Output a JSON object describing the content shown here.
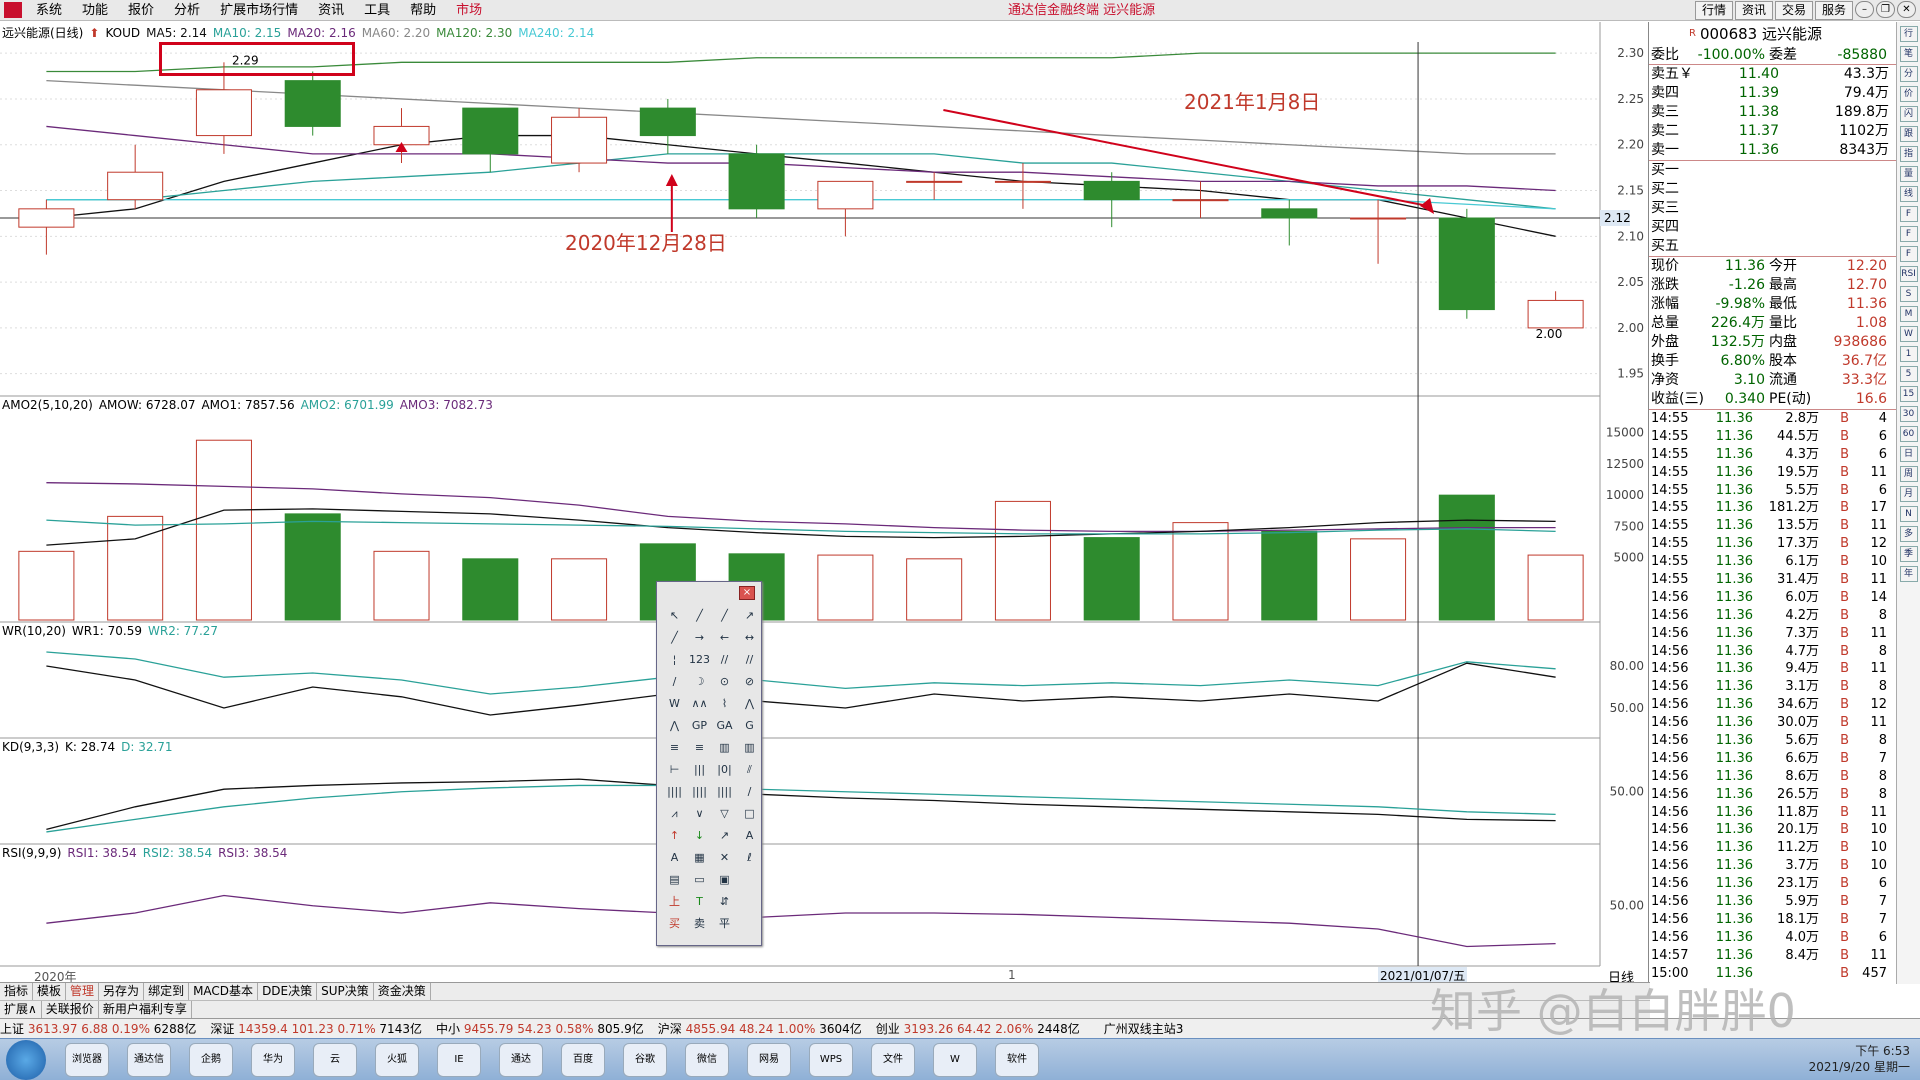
{
  "menubar": {
    "items": [
      "系统",
      "功能",
      "报价",
      "分析",
      "扩展市场行情",
      "资讯",
      "工具",
      "帮助"
    ],
    "market": "市场",
    "app_title": "通达信金融终端 远兴能源",
    "right_buttons": [
      "行情",
      "资讯",
      "交易",
      "服务"
    ]
  },
  "main_panel": {
    "title": "远兴能源(日线)",
    "indicator": "KOUD",
    "ma5": "MA5: 2.14",
    "ma10": "MA10: 2.15",
    "ma20": "MA20: 2.16",
    "ma60": "MA60: 2.20",
    "ma120": "MA120: 2.30",
    "ma240": "MA240: 2.14",
    "high_label": "2.29",
    "low_label": "2.00",
    "current_price_tag": "2.12",
    "y_ticks": [
      "2.30",
      "2.25",
      "2.20",
      "2.15",
      "2.10",
      "2.05",
      "2.00",
      "1.95"
    ]
  },
  "annotations": {
    "date1": "2021年1月8日",
    "date2": "2020年12月28日"
  },
  "amo_panel": {
    "title": "AMO2(5,10,20)",
    "amow": "AMOW: 6728.07",
    "amo1": "AMO1: 7857.56",
    "amo2": "AMO2: 6701.99",
    "amo3": "AMO3: 7082.73",
    "y_ticks": [
      "15000",
      "12500",
      "10000",
      "7500",
      "5000"
    ]
  },
  "wr_panel": {
    "title": "WR(10,20)",
    "wr1": "WR1: 70.59",
    "wr2": "WR2: 77.27",
    "y_ticks": [
      "80.00",
      "50.00"
    ]
  },
  "kd_panel": {
    "title": "KD(9,3,3)",
    "k": "K: 28.74",
    "d": "D: 32.71",
    "y_ticks": [
      "50.00"
    ]
  },
  "rsi_panel": {
    "title": "RSI(9,9,9)",
    "rsi1": "RSI1: 38.54",
    "rsi2": "RSI2: 38.54",
    "rsi3": "RSI3: 38.54",
    "y_ticks": [
      "50.00"
    ]
  },
  "x_axis": {
    "year_label": "2020年",
    "mid_label": "1",
    "date_label": "2021/01/07/五",
    "period": "日线"
  },
  "quote": {
    "code": "000683",
    "name": "远兴能源",
    "webi_label": "委比",
    "webi_value": "-100.00%",
    "weicha_label": "委差",
    "weicha_value": "-85880",
    "sells": [
      {
        "label": "卖五￥",
        "price": "11.40",
        "vol": "43.3万"
      },
      {
        "label": "卖四",
        "price": "11.39",
        "vol": "79.4万"
      },
      {
        "label": "卖三",
        "price": "11.38",
        "vol": "189.8万"
      },
      {
        "label": "卖二",
        "price": "11.37",
        "vol": "1102万"
      },
      {
        "label": "卖一",
        "price": "11.36",
        "vol": "8343万"
      }
    ],
    "buys": [
      "买一",
      "买二",
      "买三",
      "买四",
      "买五"
    ],
    "stats": [
      {
        "l1": "现价",
        "v1": "11.36",
        "l2": "今开",
        "v2": "12.20"
      },
      {
        "l1": "涨跌",
        "v1": "-1.26",
        "l2": "最高",
        "v2": "12.70"
      },
      {
        "l1": "涨幅",
        "v1": "-9.98%",
        "l2": "最低",
        "v2": "11.36"
      },
      {
        "l1": "总量",
        "v1": "226.4万",
        "l2": "量比",
        "v2": "1.08"
      },
      {
        "l1": "外盘",
        "v1": "132.5万",
        "l2": "内盘",
        "v2": "938686"
      },
      {
        "l1": "换手",
        "v1": "6.80%",
        "l2": "股本",
        "v2": "36.7亿"
      },
      {
        "l1": "净资",
        "v1": "3.10",
        "l2": "流通",
        "v2": "33.3亿"
      },
      {
        "l1": "收益(三)",
        "v1": "0.340",
        "l2": "PE(动)",
        "v2": "16.6"
      }
    ]
  },
  "trades": [
    {
      "t": "14:55",
      "p": "11.36",
      "v": "2.8万",
      "b": "B",
      "n": "4"
    },
    {
      "t": "14:55",
      "p": "11.36",
      "v": "44.5万",
      "b": "B",
      "n": "6"
    },
    {
      "t": "14:55",
      "p": "11.36",
      "v": "4.3万",
      "b": "B",
      "n": "6"
    },
    {
      "t": "14:55",
      "p": "11.36",
      "v": "19.5万",
      "b": "B",
      "n": "11"
    },
    {
      "t": "14:55",
      "p": "11.36",
      "v": "5.5万",
      "b": "B",
      "n": "6"
    },
    {
      "t": "14:55",
      "p": "11.36",
      "v": "181.2万",
      "b": "B",
      "n": "17"
    },
    {
      "t": "14:55",
      "p": "11.36",
      "v": "13.5万",
      "b": "B",
      "n": "11"
    },
    {
      "t": "14:55",
      "p": "11.36",
      "v": "17.3万",
      "b": "B",
      "n": "12"
    },
    {
      "t": "14:55",
      "p": "11.36",
      "v": "6.1万",
      "b": "B",
      "n": "10"
    },
    {
      "t": "14:55",
      "p": "11.36",
      "v": "31.4万",
      "b": "B",
      "n": "11"
    },
    {
      "t": "14:56",
      "p": "11.36",
      "v": "6.0万",
      "b": "B",
      "n": "14"
    },
    {
      "t": "14:56",
      "p": "11.36",
      "v": "4.2万",
      "b": "B",
      "n": "8"
    },
    {
      "t": "14:56",
      "p": "11.36",
      "v": "7.3万",
      "b": "B",
      "n": "11"
    },
    {
      "t": "14:56",
      "p": "11.36",
      "v": "4.7万",
      "b": "B",
      "n": "8"
    },
    {
      "t": "14:56",
      "p": "11.36",
      "v": "9.4万",
      "b": "B",
      "n": "11"
    },
    {
      "t": "14:56",
      "p": "11.36",
      "v": "3.1万",
      "b": "B",
      "n": "8"
    },
    {
      "t": "14:56",
      "p": "11.36",
      "v": "34.6万",
      "b": "B",
      "n": "12"
    },
    {
      "t": "14:56",
      "p": "11.36",
      "v": "30.0万",
      "b": "B",
      "n": "11"
    },
    {
      "t": "14:56",
      "p": "11.36",
      "v": "5.6万",
      "b": "B",
      "n": "8"
    },
    {
      "t": "14:56",
      "p": "11.36",
      "v": "6.6万",
      "b": "B",
      "n": "7"
    },
    {
      "t": "14:56",
      "p": "11.36",
      "v": "8.6万",
      "b": "B",
      "n": "8"
    },
    {
      "t": "14:56",
      "p": "11.36",
      "v": "26.5万",
      "b": "B",
      "n": "8"
    },
    {
      "t": "14:56",
      "p": "11.36",
      "v": "11.8万",
      "b": "B",
      "n": "11"
    },
    {
      "t": "14:56",
      "p": "11.36",
      "v": "20.1万",
      "b": "B",
      "n": "10"
    },
    {
      "t": "14:56",
      "p": "11.36",
      "v": "11.2万",
      "b": "B",
      "n": "10"
    },
    {
      "t": "14:56",
      "p": "11.36",
      "v": "3.7万",
      "b": "B",
      "n": "10"
    },
    {
      "t": "14:56",
      "p": "11.36",
      "v": "23.1万",
      "b": "B",
      "n": "6"
    },
    {
      "t": "14:56",
      "p": "11.36",
      "v": "5.9万",
      "b": "B",
      "n": "7"
    },
    {
      "t": "14:56",
      "p": "11.36",
      "v": "18.1万",
      "b": "B",
      "n": "7"
    },
    {
      "t": "14:56",
      "p": "11.36",
      "v": "4.0万",
      "b": "B",
      "n": "6"
    },
    {
      "t": "14:57",
      "p": "11.36",
      "v": "8.4万",
      "b": "B",
      "n": "11"
    },
    {
      "t": "15:00",
      "p": "11.36",
      "v": "",
      "b": "B",
      "n": "457"
    }
  ],
  "icon_column": [
    "行",
    "笔",
    "分",
    "价",
    "闪",
    "跟",
    "指",
    "量",
    "线",
    "F",
    "F",
    "F",
    "RSI",
    "S",
    "M",
    "W",
    "1",
    "5",
    "15",
    "30",
    "60",
    "日",
    "周",
    "月",
    "N",
    "多",
    "季",
    "年"
  ],
  "tabs1": [
    "指标",
    "模板",
    "管理",
    "另存为",
    "绑定到",
    "MACD基本",
    "DDE决策",
    "SUP决策",
    "资金决策"
  ],
  "tabs2": [
    "扩展∧",
    "关联报价",
    "新用户福利专享"
  ],
  "ticker": [
    {
      "name": "上证",
      "v": "3613.97",
      "c": "6.88",
      "p": "0.19%",
      "a": "6288亿"
    },
    {
      "name": "深证",
      "v": "14359.4",
      "c": "101.23",
      "p": "0.71%",
      "a": "7143亿"
    },
    {
      "name": "中小",
      "v": "9455.79",
      "c": "54.23",
      "p": "0.58%",
      "a": "805.9亿"
    },
    {
      "name": "沪深",
      "v": "4855.94",
      "c": "48.24",
      "p": "1.00%",
      "a": "3604亿"
    },
    {
      "name": "创业",
      "v": "3193.26",
      "c": "64.42",
      "p": "2.06%",
      "a": "2448亿"
    }
  ],
  "ticker_server": "广州双线主站3",
  "taskbar": {
    "apps": [
      "浏览器",
      "通达信",
      "企鹅",
      "华为",
      "云",
      "火狐",
      "IE",
      "通达",
      "百度",
      "谷歌",
      "微信",
      "网易",
      "WPS",
      "文件",
      "W",
      "软件"
    ],
    "time": "下午 6:53",
    "date": "2021/9/20 星期一"
  },
  "toolbox": {
    "close_label": "×",
    "tools": [
      "↖",
      "╱",
      "╱",
      "↗",
      "╱",
      "→",
      "←",
      "↔",
      "¦",
      "123",
      "//",
      "//",
      "∕",
      "☽",
      "⊙",
      "⊘",
      "W",
      "∧∧",
      "⌇",
      "⋀",
      "⋀",
      "GP",
      "GA",
      "G",
      "≡",
      "≡",
      "▥",
      "▥",
      "⊢",
      "|||",
      "|0|",
      "⫽",
      "||||",
      "||||",
      "||||",
      "∕",
      "⩘",
      "∨",
      "▽",
      "□",
      "↑",
      "↓",
      "↗",
      "A",
      "A",
      "▦",
      "✕",
      "ℓ",
      "▤",
      "▭",
      "▣",
      "",
      "上",
      "T",
      "⇵",
      "",
      "买",
      "卖",
      "平",
      ""
    ]
  },
  "watermark": "知乎 @白白胖胖0",
  "colors": {
    "up": "#c0392b",
    "down": "#2e8b2e",
    "ma_black": "#111111",
    "ma_teal": "#2aa198",
    "ma_purple": "#6b2a7a",
    "ma_cyan": "#48c9d4",
    "ma_green": "#3a8a3a",
    "ma_gray": "#888888"
  },
  "chart_data": {
    "type": "candlestick",
    "candles": [
      {
        "o": 2.11,
        "c": 2.13,
        "h": 2.14,
        "l": 2.08
      },
      {
        "o": 2.14,
        "c": 2.17,
        "h": 2.2,
        "l": 2.13
      },
      {
        "o": 2.21,
        "c": 2.26,
        "h": 2.29,
        "l": 2.19
      },
      {
        "o": 2.27,
        "c": 2.22,
        "h": 2.28,
        "l": 2.21
      },
      {
        "o": 2.2,
        "c": 2.22,
        "h": 2.24,
        "l": 2.18
      },
      {
        "o": 2.24,
        "c": 2.19,
        "h": 2.24,
        "l": 2.17
      },
      {
        "o": 2.18,
        "c": 2.23,
        "h": 2.24,
        "l": 2.17
      },
      {
        "o": 2.24,
        "c": 2.21,
        "h": 2.25,
        "l": 2.19
      },
      {
        "o": 2.19,
        "c": 2.13,
        "h": 2.2,
        "l": 2.12
      },
      {
        "o": 2.13,
        "c": 2.16,
        "h": 2.16,
        "l": 2.1
      },
      {
        "o": 2.16,
        "c": 2.16,
        "h": 2.17,
        "l": 2.14
      },
      {
        "o": 2.16,
        "c": 2.16,
        "h": 2.18,
        "l": 2.13
      },
      {
        "o": 2.16,
        "c": 2.14,
        "h": 2.17,
        "l": 2.11
      },
      {
        "o": 2.14,
        "c": 2.14,
        "h": 2.16,
        "l": 2.12
      },
      {
        "o": 2.13,
        "c": 2.12,
        "h": 2.14,
        "l": 2.09
      },
      {
        "o": 2.12,
        "c": 2.12,
        "h": 2.14,
        "l": 2.07
      },
      {
        "o": 2.12,
        "c": 2.02,
        "h": 2.13,
        "l": 2.01
      },
      {
        "o": 2.0,
        "c": 2.03,
        "h": 2.04,
        "l": 2.0
      }
    ],
    "ylim": [
      1.93,
      2.31
    ],
    "volume": [
      {
        "v": 5500,
        "up": true
      },
      {
        "v": 8300,
        "up": true
      },
      {
        "v": 14400,
        "up": true
      },
      {
        "v": 8500,
        "up": false
      },
      {
        "v": 5500,
        "up": true
      },
      {
        "v": 4900,
        "up": false
      },
      {
        "v": 4900,
        "up": true
      },
      {
        "v": 6100,
        "up": false
      },
      {
        "v": 5300,
        "up": false
      },
      {
        "v": 5200,
        "up": true
      },
      {
        "v": 4900,
        "up": true
      },
      {
        "v": 9500,
        "up": true
      },
      {
        "v": 6600,
        "up": false
      },
      {
        "v": 7800,
        "up": true
      },
      {
        "v": 7100,
        "up": false
      },
      {
        "v": 6500,
        "up": true
      },
      {
        "v": 10000,
        "up": false
      },
      {
        "v": 5200,
        "up": true
      }
    ],
    "vol_ylim": [
      0,
      16500
    ],
    "ma_lines": [
      {
        "color": "#111111",
        "values": [
          2.12,
          2.13,
          2.16,
          2.18,
          2.2,
          2.21,
          2.21,
          2.2,
          2.19,
          2.18,
          2.17,
          2.16,
          2.155,
          2.15,
          2.14,
          2.14,
          2.12,
          2.1
        ]
      },
      {
        "color": "#2aa198",
        "values": [
          2.14,
          2.14,
          2.15,
          2.16,
          2.165,
          2.17,
          2.18,
          2.19,
          2.19,
          2.19,
          2.19,
          2.18,
          2.18,
          2.17,
          2.16,
          2.15,
          2.14,
          2.13
        ]
      },
      {
        "color": "#6b2a7a",
        "values": [
          2.22,
          2.21,
          2.2,
          2.19,
          2.19,
          2.19,
          2.185,
          2.18,
          2.18,
          2.175,
          2.17,
          2.17,
          2.165,
          2.16,
          2.16,
          2.155,
          2.155,
          2.15
        ]
      },
      {
        "color": "#48c9d4",
        "values": [
          2.14,
          2.14,
          2.14,
          2.14,
          2.14,
          2.14,
          2.14,
          2.14,
          2.14,
          2.14,
          2.14,
          2.14,
          2.14,
          2.14,
          2.14,
          2.14,
          2.135,
          2.13
        ]
      },
      {
        "color": "#3a8a3a",
        "values": [
          2.28,
          2.28,
          2.285,
          2.285,
          2.29,
          2.29,
          2.29,
          2.29,
          2.295,
          2.295,
          2.295,
          2.295,
          2.295,
          2.3,
          2.3,
          2.3,
          2.3,
          2.3
        ]
      },
      {
        "color": "#888888",
        "values": [
          2.27,
          2.265,
          2.26,
          2.255,
          2.25,
          2.245,
          2.24,
          2.235,
          2.23,
          2.225,
          2.22,
          2.215,
          2.21,
          2.205,
          2.2,
          2.195,
          2.19,
          2.19
        ]
      }
    ],
    "amo_lines": [
      {
        "color": "#6b2a7a",
        "values": [
          11000,
          10900,
          10700,
          10500,
          10100,
          9800,
          9200,
          8300,
          7900,
          7700,
          7400,
          7200,
          7100,
          7100,
          7200,
          7300,
          7400,
          7400
        ]
      },
      {
        "color": "#111111",
        "values": [
          6000,
          6500,
          8800,
          8900,
          8700,
          8500,
          8000,
          7400,
          7000,
          6700,
          6600,
          6700,
          6900,
          7100,
          7400,
          7800,
          8000,
          7900
        ]
      },
      {
        "color": "#2aa198",
        "values": [
          8000,
          7600,
          7700,
          7900,
          7800,
          7700,
          7600,
          7500,
          7300,
          7100,
          7000,
          6900,
          6900,
          6900,
          7000,
          7200,
          7300,
          7100
        ]
      }
    ],
    "amo_ylim": [
      0,
      16500
    ],
    "wr_lines": [
      {
        "color": "#111111",
        "values": [
          80,
          70,
          50,
          65,
          58,
          45,
          52,
          60,
          55,
          50,
          60,
          55,
          58,
          55,
          60,
          55,
          82,
          72
        ]
      },
      {
        "color": "#2aa198",
        "values": [
          90,
          85,
          72,
          75,
          70,
          60,
          65,
          72,
          70,
          64,
          68,
          66,
          68,
          66,
          70,
          66,
          83,
          78
        ]
      }
    ],
    "wr_ylim": [
      30,
      100
    ],
    "kd_lines": [
      {
        "color": "#111111",
        "values": [
          20,
          38,
          52,
          55,
          57,
          58,
          60,
          55,
          48,
          45,
          43,
          40,
          38,
          36,
          34,
          32,
          28,
          27
        ]
      },
      {
        "color": "#2aa198",
        "values": [
          18,
          28,
          38,
          45,
          50,
          53,
          55,
          55,
          52,
          50,
          48,
          46,
          44,
          42,
          40,
          38,
          34,
          32
        ]
      }
    ],
    "kd_ylim": [
      10,
      80
    ],
    "rsi_lines": [
      {
        "color": "#6b2a7a",
        "values": [
          38,
          45,
          57,
          50,
          45,
          52,
          48,
          45,
          42,
          45,
          45,
          44,
          42,
          40,
          38,
          34,
          22,
          24
        ]
      }
    ],
    "rsi_ylim": [
      10,
      80
    ]
  }
}
